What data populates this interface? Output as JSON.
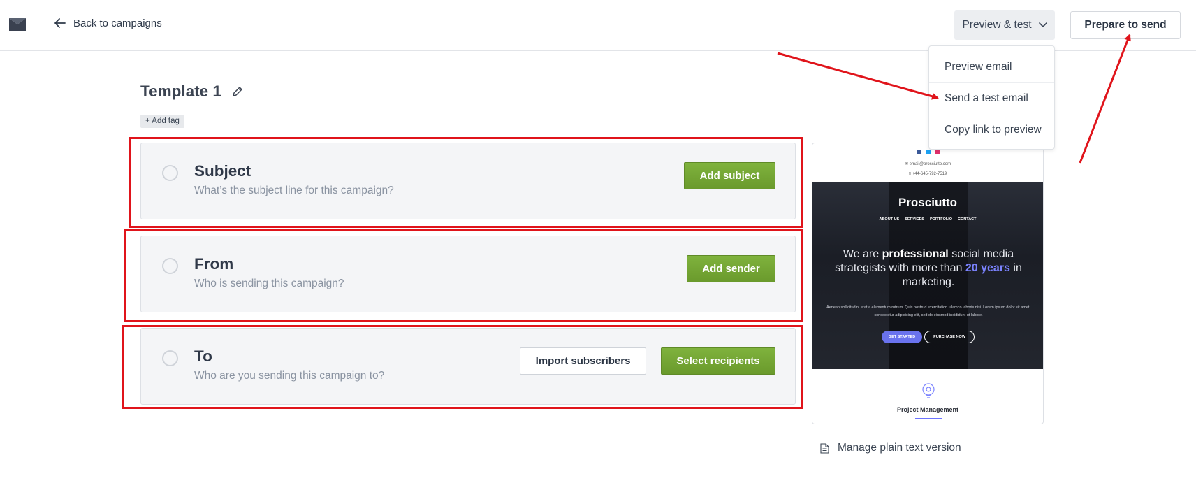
{
  "header": {
    "back_label": "Back to campaigns",
    "preview_label": "Preview & test",
    "prepare_label": "Prepare to send"
  },
  "template": {
    "title": "Template 1",
    "add_tag": "+ Add tag"
  },
  "dropdown": {
    "items": [
      "Preview email",
      "Send a test email",
      "Copy link to preview"
    ]
  },
  "cards": {
    "subject": {
      "title": "Subject",
      "subtitle": "What’s the subject line for this campaign?",
      "button": "Add subject"
    },
    "from": {
      "title": "From",
      "subtitle": "Who is sending this campaign?",
      "button": "Add sender"
    },
    "to": {
      "title": "To",
      "subtitle": "Who are you sending this campaign to?",
      "secondary_button": "Import subscribers",
      "button": "Select recipients"
    }
  },
  "email_preview": {
    "email": "email@prosciutto.com",
    "phone": "+44-645-792-7519",
    "brand": "Prosciutto",
    "nav": [
      "ABOUT US",
      "SERVICES",
      "PORTFOLIO",
      "CONTACT"
    ],
    "headline_pre": "We are ",
    "headline_bold": "professional",
    "headline_mid": " social media strategists with more than ",
    "headline_highlight": "20 years",
    "headline_post": " in marketing.",
    "body": "Aenean sollicitudin, erat a elementum rutrum. Quis nostrud exercitation ullamco laboris nisi. Lorem ipsum dolor sit amet, consectetur adipisicing elit, sed do eiusmod incididunt ut labore.",
    "cta_primary": "GET STARTED",
    "cta_secondary": "PURCHASE NOW",
    "section_title": "Project Management"
  },
  "plain_text_label": "Manage plain text version",
  "colors": {
    "green": "#6f9f2f",
    "annotation_red": "#e0141b",
    "accent_purple": "#6a73ee"
  }
}
